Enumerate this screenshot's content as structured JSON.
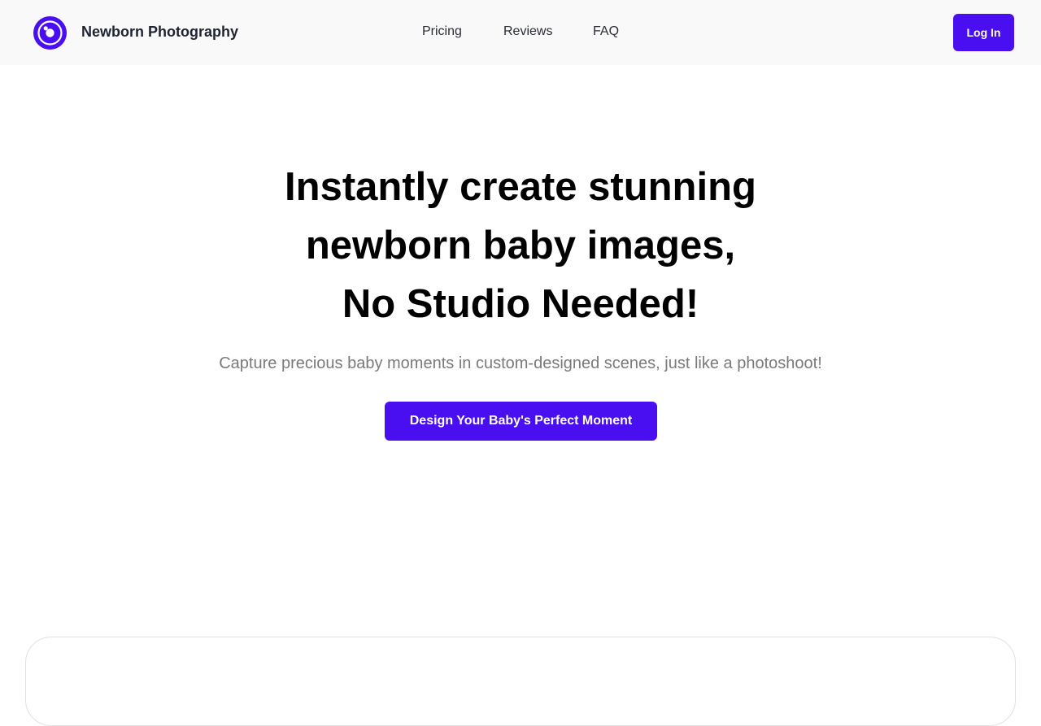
{
  "header": {
    "brand": "Newborn Photography",
    "logo_icon": "camera-lens-icon",
    "nav": [
      "Pricing",
      "Reviews",
      "FAQ"
    ],
    "login_label": "Log In"
  },
  "hero": {
    "title_lines": [
      "Instantly create stunning",
      "newborn baby images,",
      "No Studio Needed!"
    ],
    "subtitle": "Capture precious baby moments in custom-designed scenes, just like a photoshoot!",
    "cta_label": "Design Your Baby's Perfect Moment"
  },
  "colors": {
    "accent": "#4a0ff0",
    "header_bg": "#f9f9f9",
    "title_text": "#000000",
    "subtitle_text": "#7a7a7a"
  }
}
